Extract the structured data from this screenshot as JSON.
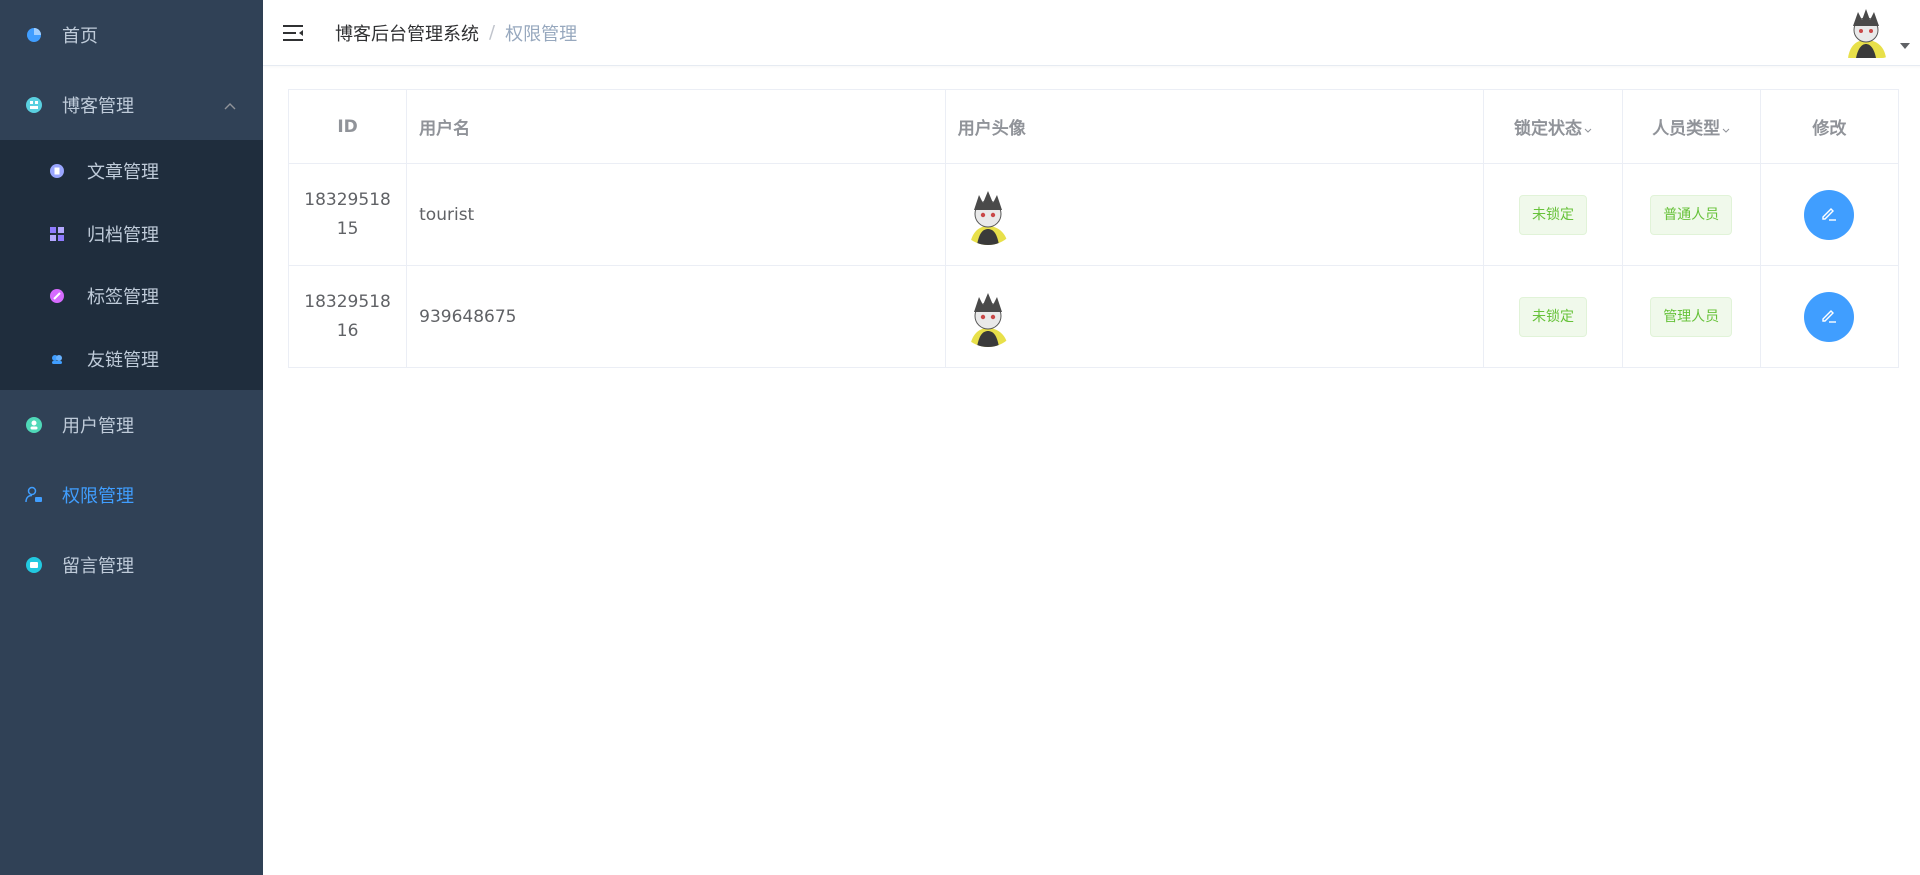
{
  "sidebar": {
    "items": [
      {
        "label": "首页",
        "icon": "dashboard-icon"
      },
      {
        "label": "博客管理",
        "icon": "blog-icon",
        "expanded": true,
        "children": [
          {
            "label": "文章管理",
            "icon": "article-icon"
          },
          {
            "label": "归档管理",
            "icon": "archive-icon"
          },
          {
            "label": "标签管理",
            "icon": "tag-icon"
          },
          {
            "label": "友链管理",
            "icon": "friend-link-icon"
          }
        ]
      },
      {
        "label": "用户管理",
        "icon": "user-icon"
      },
      {
        "label": "权限管理",
        "icon": "permission-icon",
        "active": true
      },
      {
        "label": "留言管理",
        "icon": "message-icon"
      }
    ]
  },
  "header": {
    "breadcrumb": {
      "root": "博客后台管理系统",
      "separator": "/",
      "current": "权限管理"
    }
  },
  "table": {
    "columns": {
      "id": "ID",
      "username": "用户名",
      "avatar": "用户头像",
      "lock_status": "锁定状态",
      "user_type": "人员类型",
      "edit": "修改"
    },
    "rows": [
      {
        "id": "1832951815",
        "username": "tourist",
        "lock_status": "未锁定",
        "user_type": "普通人员"
      },
      {
        "id": "1832951816",
        "username": "939648675",
        "lock_status": "未锁定",
        "user_type": "管理人员"
      }
    ]
  },
  "colors": {
    "sidebar_bg": "#304156",
    "submenu_bg": "#1f2d3d",
    "active": "#409eff",
    "tag_success": "#67c23a"
  }
}
